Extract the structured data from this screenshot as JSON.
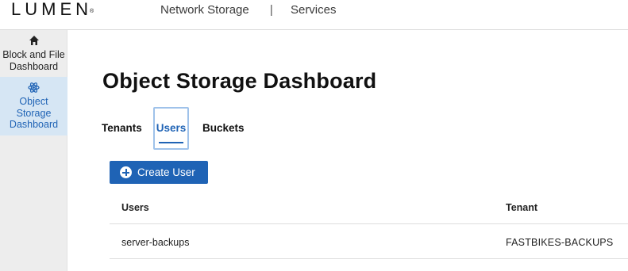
{
  "header": {
    "logo_text": "LUMEN",
    "logo_mark": "®",
    "nav": [
      "Network Storage",
      "Services"
    ],
    "separator": "|"
  },
  "sidebar": {
    "items": [
      {
        "icon": "home-icon",
        "label": "Block and File Dashboard",
        "active": false
      },
      {
        "icon": "atom-icon",
        "label": "Object Storage Dashboard",
        "active": true
      }
    ]
  },
  "main": {
    "title": "Object Storage Dashboard",
    "tabs": [
      {
        "label": "Tenants",
        "active": false
      },
      {
        "label": "Users",
        "active": true
      },
      {
        "label": "Buckets",
        "active": false
      }
    ],
    "create_button_label": "Create User",
    "table": {
      "columns": [
        "Users",
        "Tenant"
      ],
      "rows": [
        [
          "server-backups",
          "FASTBIKES-BACKUPS"
        ]
      ]
    }
  },
  "colors": {
    "accent": "#1f63b5",
    "sidebar_bg": "#ededed",
    "sidebar_active_bg": "#d6e6f4",
    "tab_focus_border": "#9fc2ea"
  }
}
